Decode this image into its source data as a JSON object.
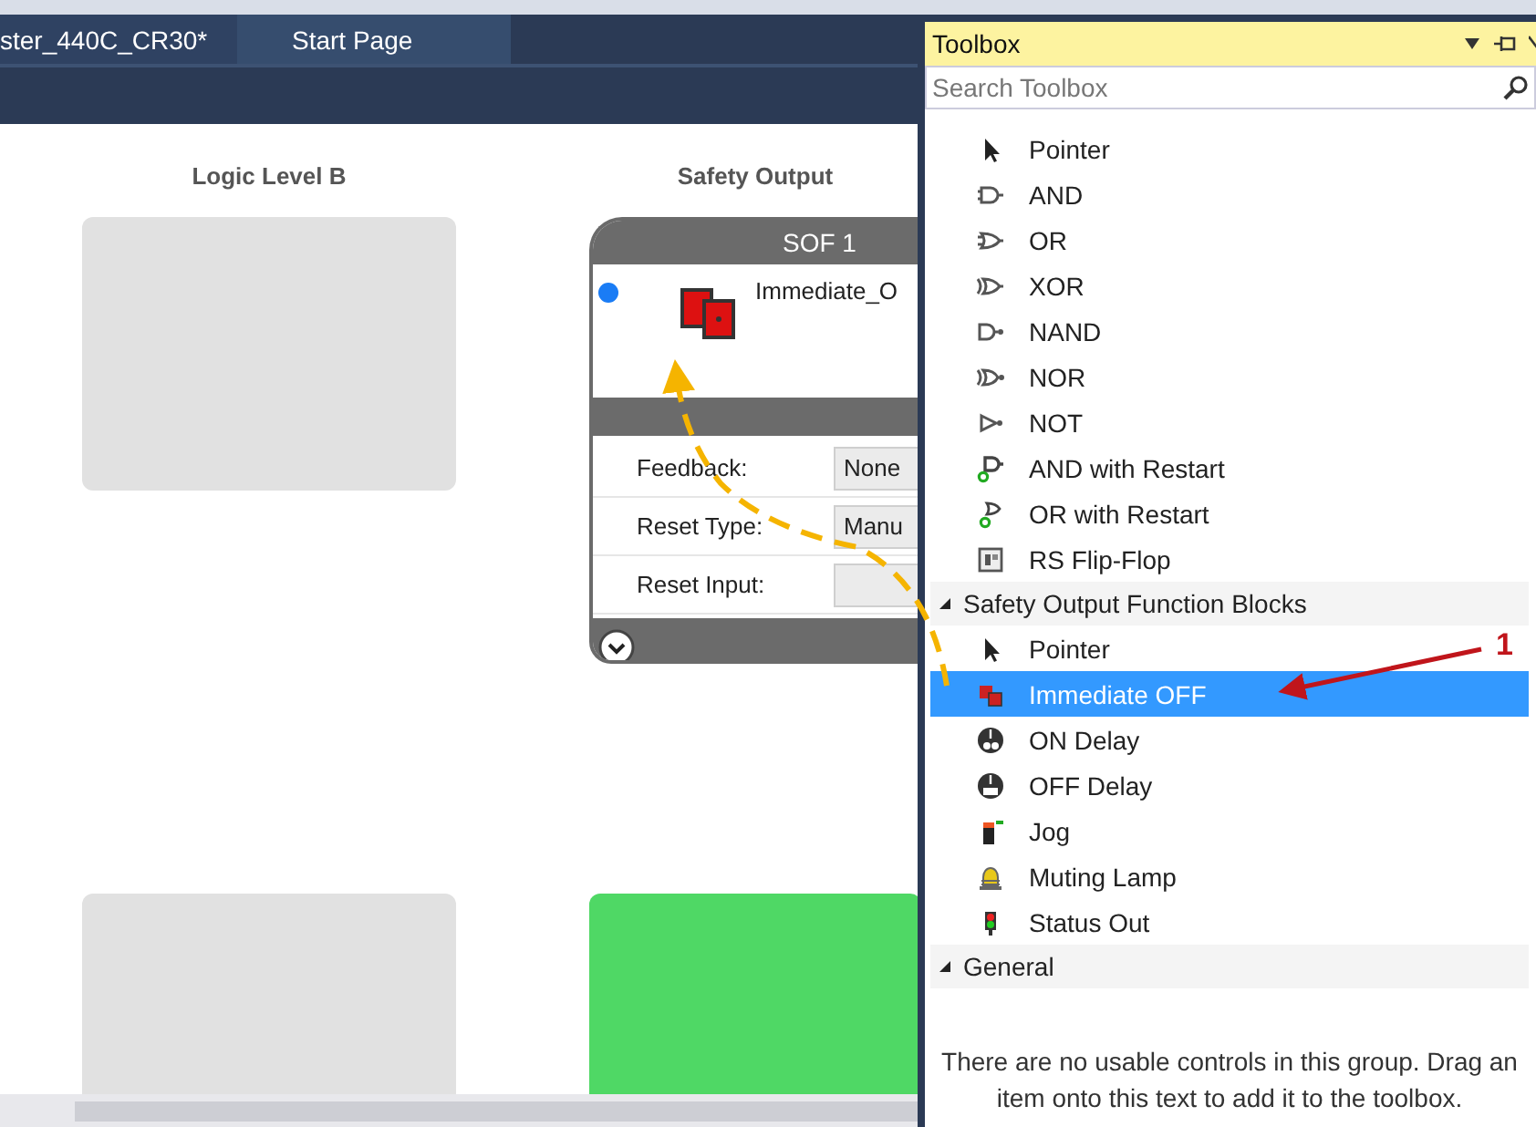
{
  "tabs": [
    {
      "label": "ster_440C_CR30*",
      "selected": false
    },
    {
      "label": "Start Page",
      "selected": true
    }
  ],
  "canvas": {
    "columns": [
      {
        "heading": "Logic Level B",
        "cards": [
          {
            "kind": "empty",
            "color": "#e1e1e1"
          },
          {
            "kind": "empty",
            "color": "#e1e1e1"
          }
        ]
      },
      {
        "heading": "Safety Output",
        "cards": [
          {
            "kind": "block",
            "title": "SOF 1",
            "name": "Immediate_O",
            "fields": [
              {
                "label": "Feedback:",
                "value": "None"
              },
              {
                "label": "Reset Type:",
                "value": "Manu"
              },
              {
                "label": "Reset Input:"
              }
            ]
          },
          {
            "kind": "empty",
            "color": "#4fd865"
          }
        ]
      }
    ]
  },
  "toolbox": {
    "title": "Toolbox",
    "search": {
      "placeholder": "Search Toolbox"
    },
    "groups": [
      {
        "items": [
          {
            "label": "Pointer",
            "kind": "pointer",
            "selected": false
          },
          {
            "label": "AND",
            "kind": "and",
            "selected": false
          },
          {
            "label": "OR",
            "kind": "or",
            "selected": false
          },
          {
            "label": "XOR",
            "kind": "xor",
            "selected": false
          },
          {
            "label": "NAND",
            "kind": "nand",
            "selected": false
          },
          {
            "label": "NOR",
            "kind": "nor",
            "selected": false
          },
          {
            "label": "NOT",
            "kind": "not",
            "selected": false
          },
          {
            "label": "AND with Restart",
            "kind": "and-restart",
            "selected": false
          },
          {
            "label": "OR with Restart",
            "kind": "or-restart",
            "selected": false
          },
          {
            "label": "RS Flip-Flop",
            "kind": "flipflop",
            "selected": false
          }
        ]
      },
      {
        "title": "Safety Output Function Blocks",
        "expanded": true,
        "items": [
          {
            "label": "Pointer",
            "kind": "pointer",
            "selected": false
          },
          {
            "label": "Immediate OFF",
            "kind": "immediate",
            "selected": true
          },
          {
            "label": "ON Delay",
            "kind": "on-delay",
            "selected": false
          },
          {
            "label": "OFF Delay",
            "kind": "off-delay",
            "selected": false
          },
          {
            "label": "Jog",
            "kind": "jog",
            "selected": false
          },
          {
            "label": "Muting Lamp",
            "kind": "lamp",
            "selected": false
          },
          {
            "label": "Status Out",
            "kind": "status",
            "selected": false
          }
        ]
      },
      {
        "title": "General",
        "expanded": true,
        "empty_message": "There are no usable controls in this group. Drag an item onto this text to add it to the toolbox."
      }
    ]
  },
  "annotations": [
    {
      "label": "1"
    }
  ]
}
